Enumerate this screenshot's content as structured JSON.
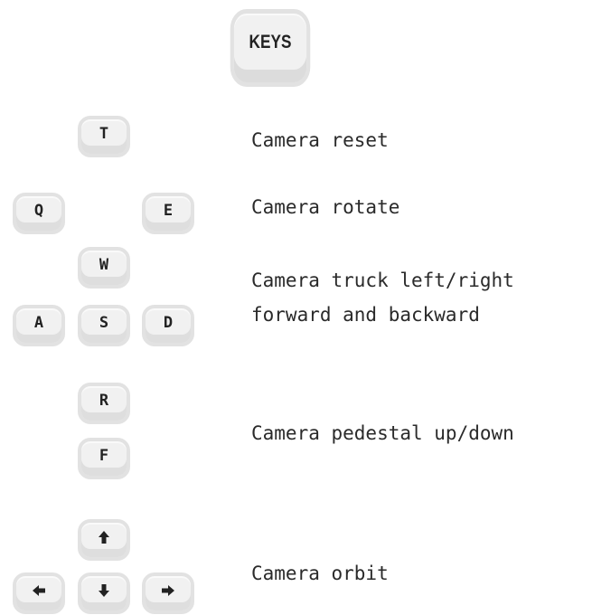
{
  "title": "KEYS",
  "keys": {
    "t": "T",
    "q": "Q",
    "e": "E",
    "w": "W",
    "a": "A",
    "s": "S",
    "d": "D",
    "r": "R",
    "f": "F",
    "up": "up-arrow-icon",
    "left": "left-arrow-icon",
    "down": "down-arrow-icon",
    "right": "right-arrow-icon"
  },
  "descriptions": {
    "reset": "Camera reset",
    "rotate": "Camera rotate",
    "truck_line1": "Camera truck left/right",
    "truck_line2": "forward and backward",
    "pedestal": "Camera pedestal up/down",
    "orbit": "Camera orbit"
  }
}
